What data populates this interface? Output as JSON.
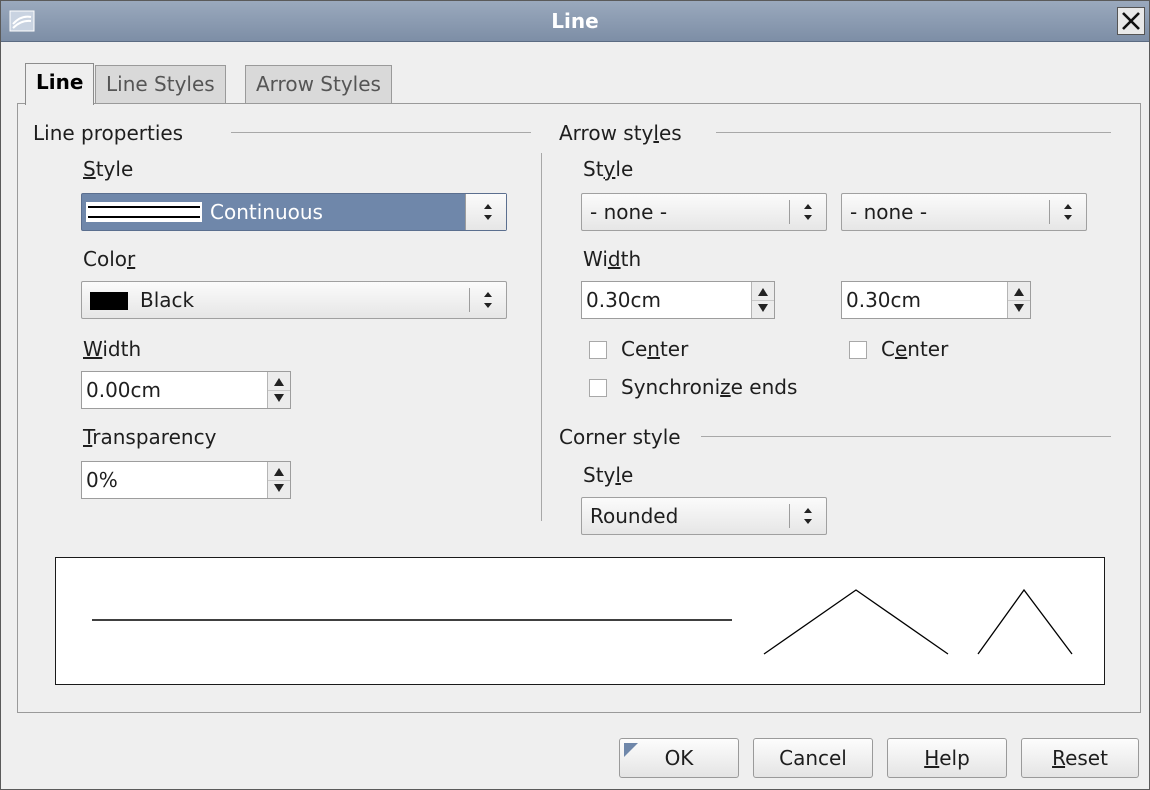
{
  "window": {
    "title": "Line"
  },
  "tabs": [
    {
      "label": "Line",
      "active": true
    },
    {
      "label": "Line Styles",
      "active": false
    },
    {
      "label": "Arrow Styles",
      "active": false
    }
  ],
  "line_properties": {
    "heading": "Line properties",
    "style_label_pre": "",
    "style_label_key": "S",
    "style_label_post": "tyle",
    "style_value": "Continuous",
    "color_label_pre": "Colo",
    "color_label_key": "r",
    "color_label_post": "",
    "color_value": "Black",
    "color_swatch": "#000000",
    "width_label_pre": "",
    "width_label_key": "W",
    "width_label_post": "idth",
    "width_value": "0.00cm",
    "transparency_label_pre": "",
    "transparency_label_key": "T",
    "transparency_label_post": "ransparency",
    "transparency_value": "0%"
  },
  "arrow_styles": {
    "heading_pre": "Arrow sty",
    "heading_key": "l",
    "heading_post": "es",
    "style_label_pre": "St",
    "style_label_key": "y",
    "style_label_post": "le",
    "start_style": "- none -",
    "end_style": "- none -",
    "width_label_pre": "Wi",
    "width_label_key": "d",
    "width_label_post": "th",
    "start_width": "0.30cm",
    "end_width": "0.30cm",
    "center_start_pre": "Ce",
    "center_start_key": "n",
    "center_start_post": "ter",
    "center_end_pre": "C",
    "center_end_key": "e",
    "center_end_post": "nter",
    "sync_pre": "Synchroni",
    "sync_key": "z",
    "sync_post": "e ends"
  },
  "corner_style": {
    "heading": "Corner style",
    "style_label_pre": "Sty",
    "style_label_key": "l",
    "style_label_post": "e",
    "style_value": "Rounded"
  },
  "buttons": {
    "ok": "OK",
    "cancel": "Cancel",
    "help_key": "H",
    "help_post": "elp",
    "reset_key": "R",
    "reset_post": "eset"
  },
  "colors": {
    "titlebar": "#8797af",
    "selected_combo": "#6f87aa",
    "window_bg": "#efefef"
  }
}
